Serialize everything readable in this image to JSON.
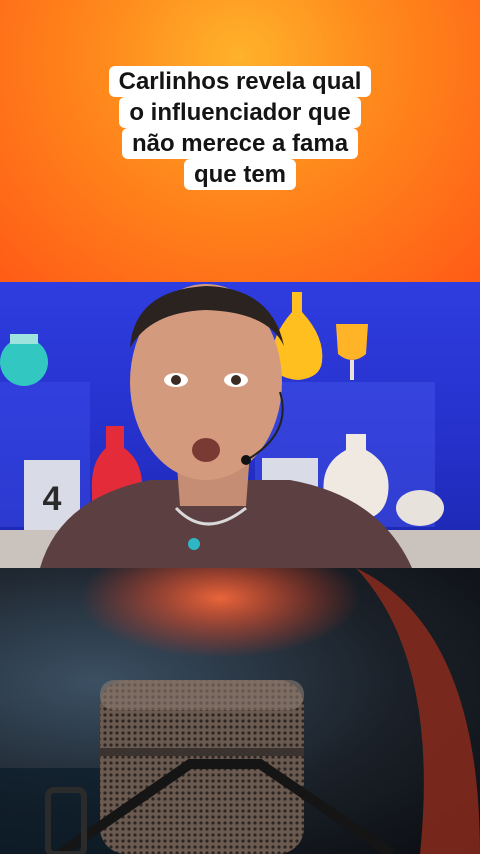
{
  "caption": {
    "lines": [
      "Carlinhos revela qual",
      "o influenciador que",
      "não merece a fama",
      "que tem"
    ]
  },
  "video": {
    "number_sign": "4"
  },
  "colors": {
    "header_orange": "#ff7a1c",
    "set_blue": "#2a36d6",
    "caption_bg": "#ffffff"
  }
}
